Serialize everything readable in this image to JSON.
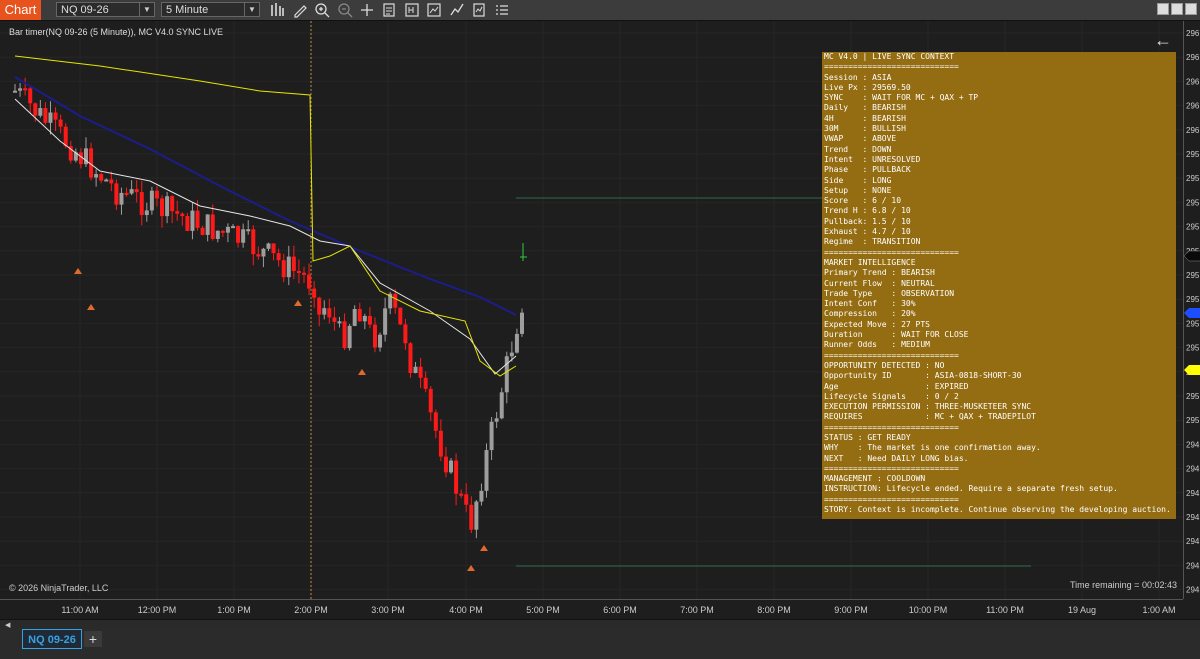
{
  "toolbar": {
    "chart_tab": "Chart",
    "instrument": "NQ 09-26",
    "interval": "5 Minute",
    "icons": [
      "bar-type-icon",
      "draw-tool-icon",
      "zoom-in-icon",
      "zoom-out-icon",
      "crosshair-icon",
      "data-box-icon",
      "hot-keys-icon",
      "properties-icon",
      "strategy-icon",
      "indicators-icon",
      "template-icon"
    ],
    "window_buttons": [
      "minimize-icon",
      "restore-icon",
      "close-icon"
    ]
  },
  "chart": {
    "title": "Bar timer(NQ 09-26 (5 Minute)), MC V4.0 SYNC LIVE",
    "copyright": "© 2026 NinjaTrader, LLC",
    "time_remaining": "Time remaining = 00:02:43",
    "time_ticks": [
      "11:00 AM",
      "12:00 PM",
      "1:00 PM",
      "2:00 PM",
      "3:00 PM",
      "4:00 PM",
      "5:00 PM",
      "6:00 PM",
      "7:00 PM",
      "8:00 PM",
      "9:00 PM",
      "10:00 PM",
      "11:00 PM",
      "19 Aug",
      "1:00 AM"
    ],
    "price_ticks": [
      "296",
      "296",
      "296",
      "296",
      "296",
      "295",
      "295",
      "295",
      "295",
      "295",
      "295",
      "295",
      "295",
      "295",
      "295",
      "295",
      "295",
      "294",
      "294",
      "294",
      "294",
      "294",
      "294",
      "294",
      "294"
    ],
    "colors": {
      "bull": "#9e9e9e",
      "bear": "#ff1a1a",
      "vwap": "#e6e600",
      "ma_slow": "#1c1c8c",
      "ma_fast": "#e6e6e6",
      "session_line": "#c78a3a",
      "signal": "#e06a2c",
      "panel_bg": "#946d12",
      "price_marker_blue": "#1e4cff",
      "price_marker_yellow": "#ffff00"
    }
  },
  "panel": {
    "lines": [
      "MC V4.0 | LIVE SYNC CONTEXT",
      "============================",
      "Session : ASIA",
      "Live Px : 29569.50",
      "SYNC    : WAIT FOR MC + QAX + TP",
      "Daily   : BEARISH",
      "4H      : BEARISH",
      "30M     : BULLISH",
      "VWAP    : ABOVE",
      "Trend   : DOWN",
      "Intent  : UNRESOLVED",
      "Phase   : PULLBACK",
      "Side    : LONG",
      "Setup   : NONE",
      "Score   : 6 / 10",
      "Trend H : 6.8 / 10",
      "Pullback: 1.5 / 10",
      "Exhaust : 4.7 / 10",
      "Regime  : TRANSITION",
      "============================",
      "MARKET INTELLIGENCE",
      "Primary Trend : BEARISH",
      "Current Flow  : NEUTRAL",
      "Trade Type    : OBSERVATION",
      "Intent Conf   : 30%",
      "Compression   : 20%",
      "Expected Move : 27 PTS",
      "Duration      : WAIT FOR CLOSE",
      "Runner Odds   : MEDIUM",
      "============================",
      "OPPORTUNITY DETECTED : NO",
      "Opportunity ID       : ASIA-0818-SHORT-30",
      "Age                  : EXPIRED",
      "Lifecycle Signals    : 0 / 2",
      "EXECUTION PERMISSION : THREE-MUSKETEER SYNC",
      "REQUIRES             : MC + QAX + TRADEPILOT",
      "============================",
      "STATUS : GET READY",
      "WHY    : The market is one confirmation away.",
      "NEXT   : Need DAILY LONG bias.",
      "============================",
      "MANAGEMENT : COOLDOWN",
      "INSTRUCTION: Lifecycle ended. Require a separate fresh setup.",
      "============================",
      "STORY: Context is incomplete. Continue observing the developing auction."
    ]
  },
  "tabs": {
    "instrument_tab": "NQ 09-26",
    "add_tab": "+"
  }
}
